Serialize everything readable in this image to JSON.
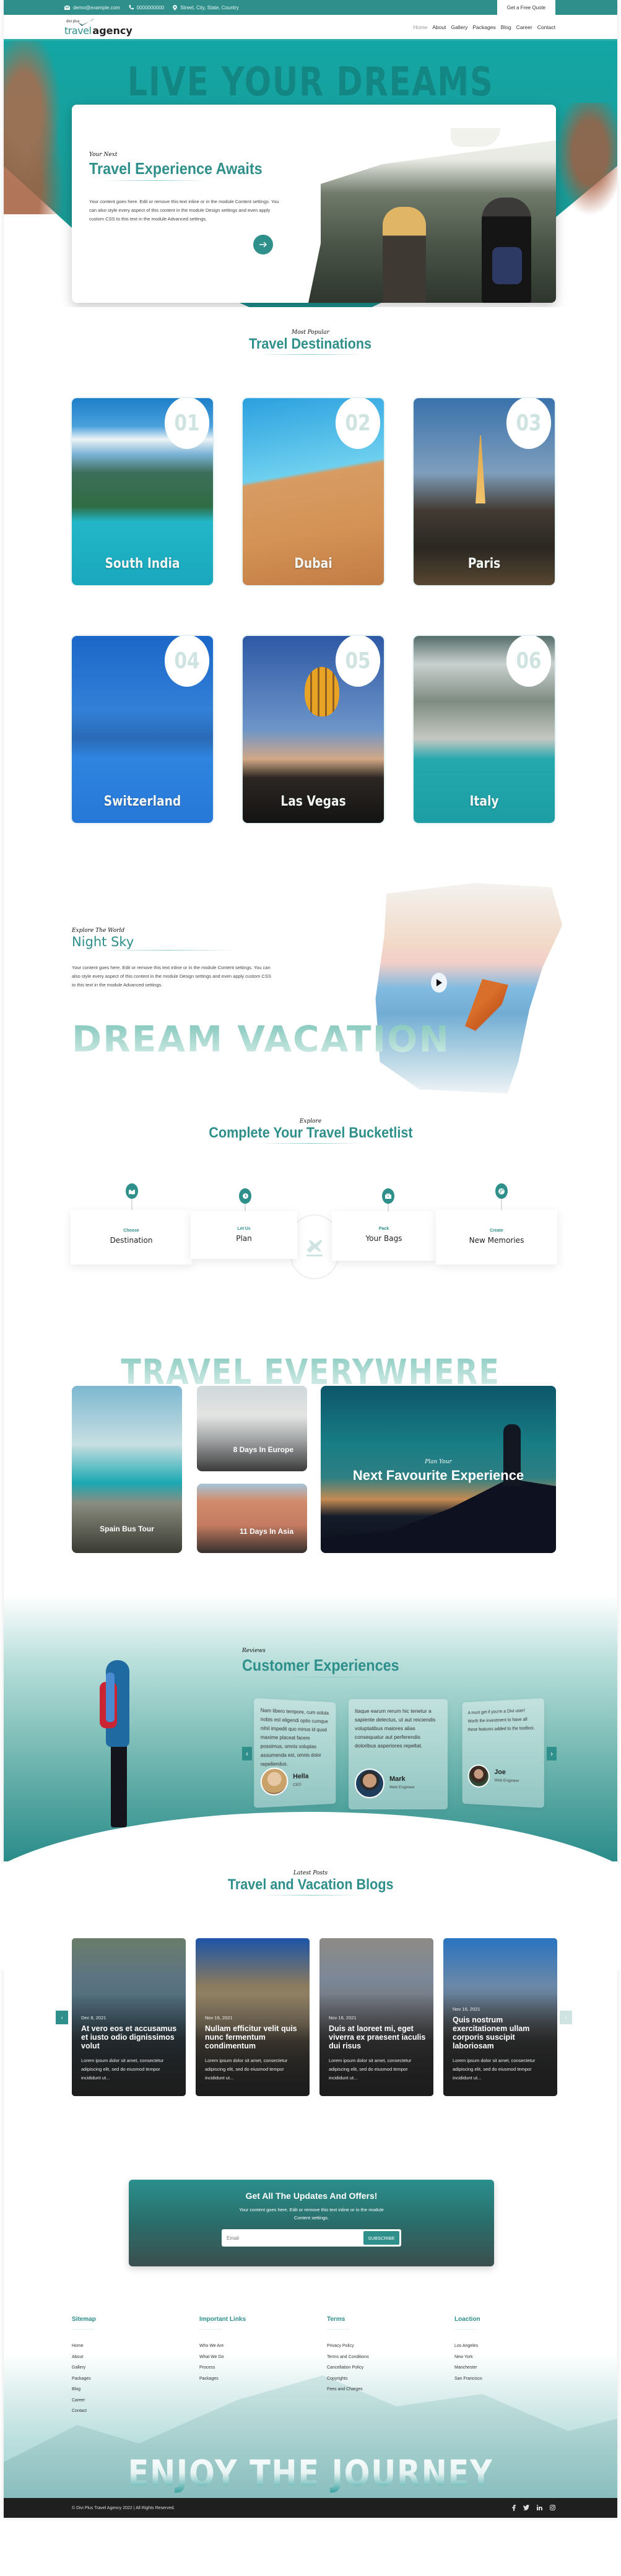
{
  "topbar": {
    "email": "demo@example.com",
    "phone": "0000000000",
    "address": "Street, City, State, Country",
    "quote_button": "Get a Free Quote"
  },
  "header": {
    "logo_small": "divi plus",
    "logo_travel": "travel",
    "logo_agency": "agency",
    "nav": [
      "Home",
      "About",
      "Gallery",
      "Packages",
      "Blog",
      "Career",
      "Contact"
    ],
    "active_nav": "Home"
  },
  "hero": {
    "background_text": "LIVE YOUR DREAMS",
    "kicker": "Your Next",
    "title": "Travel Experience Awaits",
    "text": "Your content goes here. Edit or remove this text inline or in the module Content settings. You can also style every aspect of this content in the module Design settings and even apply custom CSS to this text in the module Advanced settings.",
    "button_icon": "arrow-right-icon"
  },
  "destinations": {
    "kicker": "Most Popular",
    "title": "Travel Destinations",
    "items": [
      {
        "number": "01",
        "name": "South India"
      },
      {
        "number": "02",
        "name": "Dubai"
      },
      {
        "number": "03",
        "name": "Paris"
      },
      {
        "number": "04",
        "name": "Switzerland"
      },
      {
        "number": "05",
        "name": "Las Vegas"
      },
      {
        "number": "06",
        "name": "Italy"
      }
    ]
  },
  "night_sky": {
    "kicker": "Explore The World",
    "title": "Night Sky",
    "text": "Your content goes here. Edit or remove this text inline or in the module Content settings. You can also style every aspect of this content in the module Design settings and even apply custom CSS to this text in the module Advanced settings.",
    "background_text": "DREAM VACATION",
    "play_icon": "play-icon"
  },
  "bucketlist": {
    "kicker": "Explore",
    "title": "Complete Your Travel Bucketlist",
    "steps": [
      {
        "label": "Choose",
        "value": "Destination",
        "icon": "map-pin-icon"
      },
      {
        "label": "Let Us",
        "value": "Plan",
        "icon": "clock-icon"
      },
      {
        "label": "Pack",
        "value": "Your Bags",
        "icon": "briefcase-icon"
      },
      {
        "label": "Create",
        "value": "New Memories",
        "icon": "globe-icon"
      }
    ]
  },
  "everywhere": {
    "background_text": "TRAVEL EVERYWHERE",
    "tiles": [
      {
        "label": "Spain Bus Tour"
      },
      {
        "label": "8 Days In Europe"
      },
      {
        "label": "11 Days In Asia"
      }
    ],
    "feature_kicker": "Plan Your",
    "feature_title": "Next Favourite Experience"
  },
  "reviews": {
    "kicker": "Reviews",
    "title": "Customer Experiences",
    "items": [
      {
        "text": "Nam libero tempore, cum soluta nobis est eligendi optio cumque nihil impedit quo minus id quod maxime placeat facere possimus, omnis voluptas assumenda est, omnis dolor repellendus.",
        "name": "Hella",
        "role": "CEO"
      },
      {
        "text": "Itaque earum rerum hic tenetur a sapiente delectus, ut aut reiciendis voluptatibus maiores alias consequatur aut perferendis doloribus asperiores repellat.",
        "name": "Mark",
        "role": "Web Engineer"
      },
      {
        "text": "A must get if you're a Divi user! Worth the investment to have all these features added to the toolbox.",
        "name": "Joe",
        "role": "Web Engineer"
      }
    ],
    "prev": "‹",
    "next": "›"
  },
  "blogs": {
    "kicker": "Latest Posts",
    "title": "Travel and Vacation Blogs",
    "posts": [
      {
        "date": "Dec 8, 2021",
        "title": "At vero eos et accusamus et iusto odio dignissimos volut",
        "excerpt": "Lorem ipsum dolor sit amet, consectetur adipiscing elit, sed do eiusmod tempor incididunt ut..."
      },
      {
        "date": "Nov 16, 2021",
        "title": "Nullam efficitur velit quis nunc fermentum condimentum",
        "excerpt": "Lorem ipsum dolor sit amet, consectetur adipiscing elit, sed do eiusmod tempor incididunt ut..."
      },
      {
        "date": "Nov 16, 2021",
        "title": "Duis at laoreet mi, eget viverra ex praesent iaculis dui risus",
        "excerpt": "Lorem ipsum dolor sit amet, consectetur adipiscing elit, sed do eiusmod tempor incididunt ut..."
      },
      {
        "date": "Nov 16, 2021",
        "title": "Quis nostrum exercitationem ullam corporis suscipit laboriosam",
        "excerpt": "Lorem ipsum dolor sit amet, consectetur adipiscing elit, sed do eiusmod tempor incididunt ut..."
      }
    ],
    "prev": "‹",
    "next": "›"
  },
  "newsletter": {
    "title": "Get All The Updates And Offers!",
    "text": "Your content goes here. Edit or remove this text inline or in the module Content settings.",
    "email_placeholder": "Email",
    "email_value": "",
    "button": "SUBSCRIBE"
  },
  "footer": {
    "columns": [
      {
        "heading": "Sitemap",
        "links": [
          "Home",
          "About",
          "Gallery",
          "Packages",
          "Blog",
          "Career",
          "Contact"
        ]
      },
      {
        "heading": "Important Links",
        "links": [
          "Who We Are",
          "What We Do",
          "Process",
          "Packages"
        ]
      },
      {
        "heading": "Terms",
        "links": [
          "Privacy Policy",
          "Terms and Conditions",
          "Cancellation Policy",
          "Copyrights",
          "Fees and Charges"
        ]
      },
      {
        "heading": "Loaction",
        "links": [
          "Los Angeles",
          "New York",
          "Manchester",
          "San Francisco"
        ]
      }
    ],
    "background_text": "ENJOY THE JOURNEY",
    "copyright": "© Divi Plus Travel Agency 2022 | All Rights Reserved.",
    "social": [
      "facebook-icon",
      "twitter-icon",
      "linkedin-icon",
      "instagram-icon"
    ]
  },
  "colors": {
    "brand": "#2f8f8b",
    "brand_light": "#cfe4e1",
    "dark": "#1f1f1f"
  }
}
